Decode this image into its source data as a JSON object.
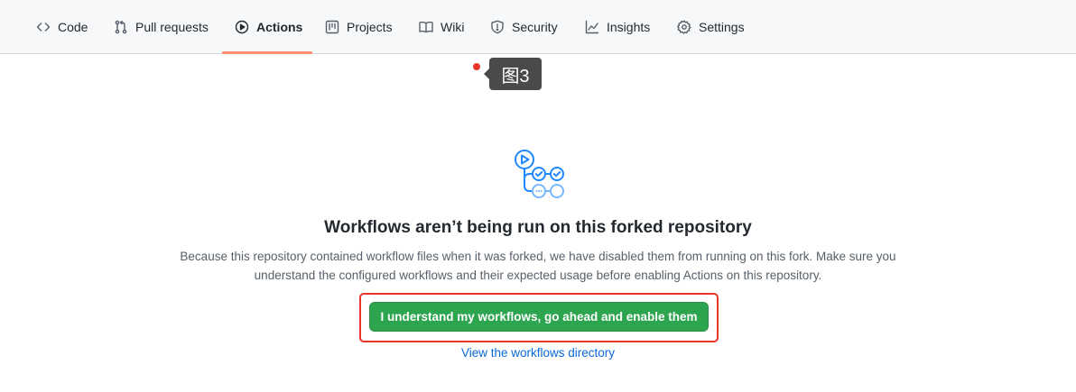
{
  "tabs": [
    {
      "label": "Code",
      "icon": "code-icon"
    },
    {
      "label": "Pull requests",
      "icon": "pull-request-icon"
    },
    {
      "label": "Actions",
      "icon": "play-icon",
      "active": true
    },
    {
      "label": "Projects",
      "icon": "project-board-icon"
    },
    {
      "label": "Wiki",
      "icon": "book-icon"
    },
    {
      "label": "Security",
      "icon": "shield-icon"
    },
    {
      "label": "Insights",
      "icon": "graph-icon"
    },
    {
      "label": "Settings",
      "icon": "gear-icon"
    }
  ],
  "annotation": {
    "label": "图3"
  },
  "main": {
    "illustration": "workflow-icon",
    "heading": "Workflows aren’t being run on this forked repository",
    "description": "Because this repository contained workflow files when it was forked, we have disabled them from running on this fork. Make sure you understand the configured workflows and their expected usage before enabling Actions on this repository.",
    "enable_button": "I understand my workflows, go ahead and enable them",
    "directory_link": "View the workflows directory"
  },
  "colors": {
    "accent_underline": "#fd8c73",
    "primary_button": "#2da44e",
    "link": "#0969da",
    "highlight_frame": "#e8352c",
    "illustration": "#2188ff"
  }
}
